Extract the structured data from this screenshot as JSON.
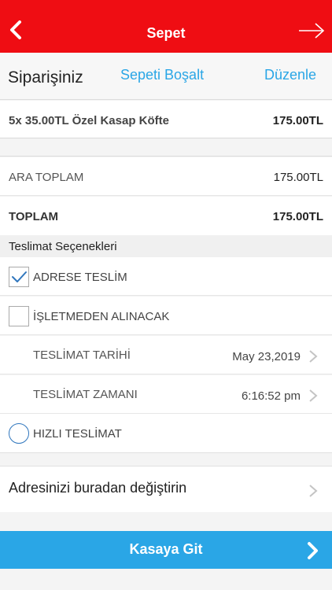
{
  "navbar": {
    "title": "Sepet",
    "back_icon": "chevron-left-icon",
    "next_icon": "arrow-right-icon"
  },
  "order_header": {
    "title": "Siparişiniz",
    "clear_label": "Sepeti Boşalt",
    "edit_label": "Düzenle"
  },
  "cart": {
    "items": [
      {
        "description": "5x 35.00TL Özel Kasap Köfte",
        "price": "175.00TL"
      }
    ],
    "subtotal_label": "ARA TOPLAM",
    "subtotal_value": "175.00TL",
    "total_label": "TOPLAM",
    "total_value": "175.00TL"
  },
  "delivery": {
    "section_title": "Teslimat Seçenekleri",
    "options": [
      {
        "label": "ADRESE TESLİM",
        "checked": true
      },
      {
        "label": "İŞLETMEDEN ALINACAK",
        "checked": false
      }
    ],
    "date_label": "TESLİMAT TARİHİ",
    "date_value": "May 23,2019",
    "time_label": "TESLİMAT ZAMANI",
    "time_value": "6:16:52 pm",
    "express_label": "HIZLI TESLİMAT",
    "express_selected": false
  },
  "address": {
    "label": "Adresinizi buradan değiştirin"
  },
  "checkout": {
    "label": "Kasaya Git"
  },
  "colors": {
    "brand_red": "#ef0d13",
    "accent_blue": "#2aa6e6",
    "check_blue": "#2f76bd"
  }
}
